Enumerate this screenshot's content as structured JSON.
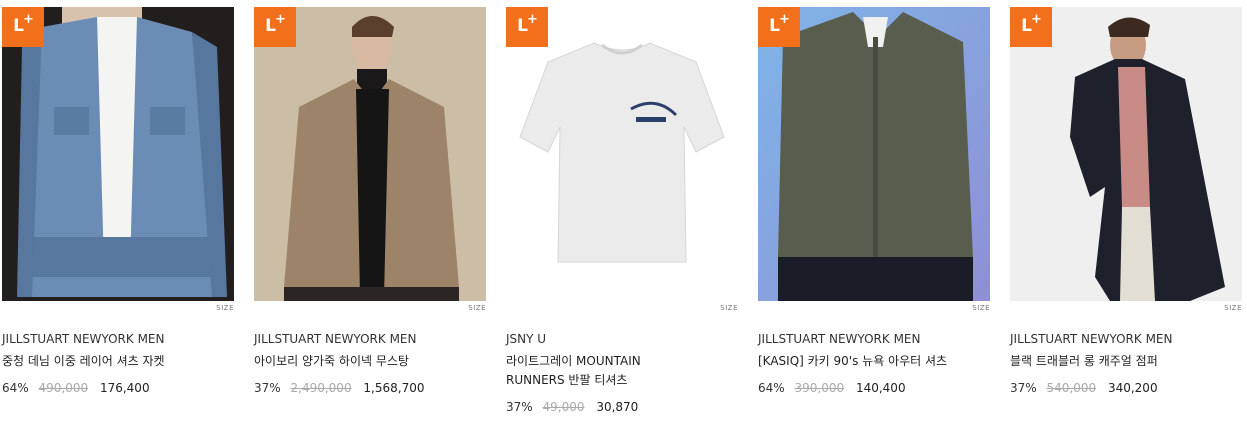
{
  "badge_label": "L",
  "badge_plus": "+",
  "size_label": "SIZE",
  "products": [
    {
      "brand": "JILLSTUART NEWYORK MEN",
      "name": "중청 데님 이중 레이어 셔츠 자켓",
      "discount": "64%",
      "original_price": "490,000",
      "sale_price": "176,400",
      "image_bg": "#231f1f",
      "image_subject": "denim-jacket"
    },
    {
      "brand": "JILLSTUART NEWYORK MEN",
      "name": "아이보리 양가죽 하이넥 무스탕",
      "discount": "37%",
      "original_price": "2,490,000",
      "sale_price": "1,568,700",
      "image_bg": "#cbbda4",
      "image_subject": "beige-mustang"
    },
    {
      "brand": "JSNY U",
      "name": "라이트그레이 MOUNTAIN RUNNERS 반팔 티셔츠",
      "discount": "37%",
      "original_price": "49,000",
      "sale_price": "30,870",
      "image_bg": "#ffffff",
      "image_subject": "gray-tshirt"
    },
    {
      "brand": "JILLSTUART NEWYORK MEN",
      "name": "[KASIQ] 카키 90's 뉴욕 아우터 셔츠",
      "discount": "64%",
      "original_price": "390,000",
      "sale_price": "140,400",
      "image_bg": "#6fa6dd",
      "image_subject": "khaki-shirt"
    },
    {
      "brand": "JILLSTUART NEWYORK MEN",
      "name": "블랙 트래블러 롱 캐주얼 점퍼",
      "discount": "37%",
      "original_price": "540,000",
      "sale_price": "340,200",
      "image_bg": "#efefef",
      "image_subject": "black-long-jumper"
    }
  ]
}
